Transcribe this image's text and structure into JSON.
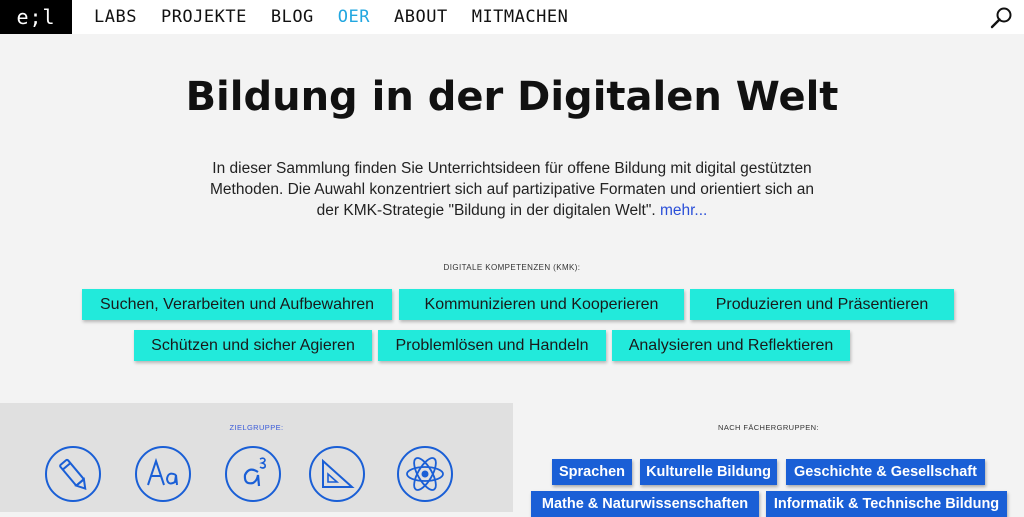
{
  "header": {
    "logo": "e;l",
    "nav": [
      "LABS",
      "PROJEKTE",
      "BLOG",
      "OER",
      "ABOUT",
      "MITMACHEN"
    ],
    "active_nav": "OER",
    "accent_color": "#22a7e0"
  },
  "hero": {
    "title": "Bildung in der Digitalen Welt",
    "intro_line1": "In dieser Sammlung finden Sie Unterrichtsideen für offene Bildung mit digital gestützten",
    "intro_line2": "Methoden. Die Auwahl konzentriert sich auf partizipative Formaten und orientiert sich an",
    "intro_line3": "der KMK-Strategie \"Bildung in der digitalen Welt\".",
    "more_link": "mehr..."
  },
  "kmk": {
    "label": "DIGITALE KOMPETENZEN (KMK):",
    "chip_color": "#22eadb",
    "items": [
      "Suchen, Verarbeiten und Aufbewahren",
      "Kommunizieren und Kooperieren",
      "Produzieren und Präsentieren",
      "Schützen und sicher Agieren",
      "Problemlösen und Handeln",
      "Analysieren und Reflektieren"
    ]
  },
  "zielgruppe": {
    "label": "ZIELGRUPPE:",
    "icons": [
      "pencil-icon",
      "letters-icon",
      "math-icon",
      "triangle-ruler-icon",
      "atom-icon"
    ],
    "icon_color": "#1a5fd6"
  },
  "faecher": {
    "label": "NACH FÄCHERGRUPPEN:",
    "button_color": "#1a5fd6",
    "items": [
      "Sprachen",
      "Kulturelle Bildung",
      "Geschichte & Gesellschaft",
      "Mathe & Naturwissenschaften",
      "Informatik & Technische Bildung"
    ]
  }
}
